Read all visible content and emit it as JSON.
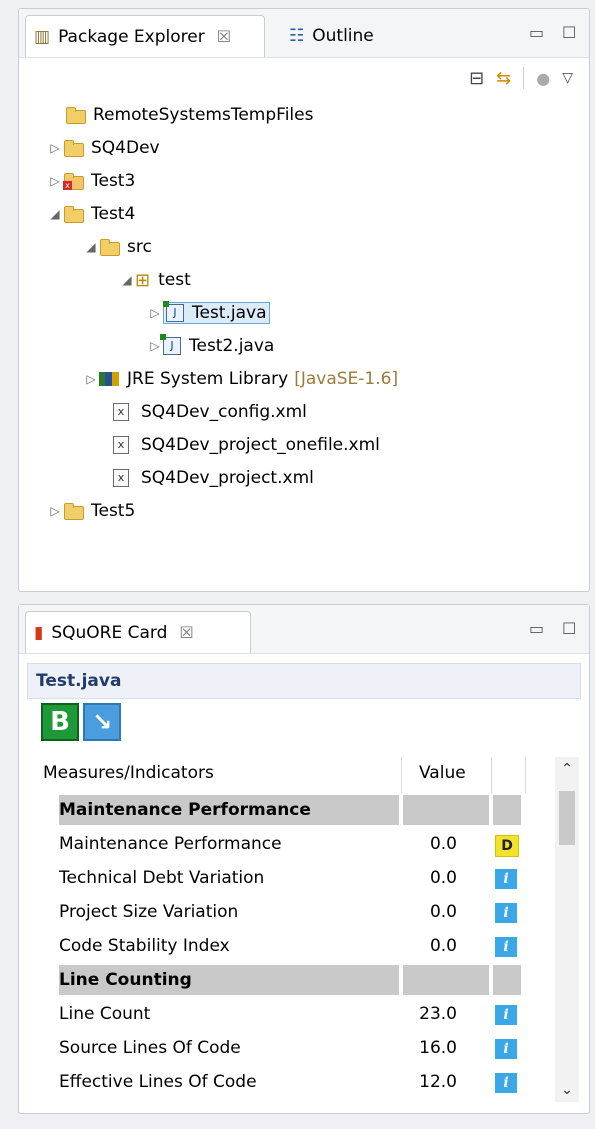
{
  "explorer": {
    "tab_label": "Package Explorer",
    "close_glyph": "☒",
    "outline_tab_label": "Outline",
    "tree": [
      {
        "label": "RemoteSystemsTempFiles",
        "level": 1,
        "twisty": "",
        "icon": "folder-icon"
      },
      {
        "label": "SQ4Dev",
        "level": 1,
        "twisty": "▷",
        "icon": "project-folder-icon"
      },
      {
        "label": "Test3",
        "level": 1,
        "twisty": "▷",
        "icon": "project-error-icon"
      },
      {
        "label": "Test4",
        "level": 1,
        "twisty": "◢",
        "icon": "project-folder-icon"
      },
      {
        "label": "src",
        "level": 2,
        "twisty": "◢",
        "icon": "source-folder-icon"
      },
      {
        "label": "test",
        "level": 3,
        "twisty": "◢",
        "icon": "package-icon"
      },
      {
        "label": "Test.java",
        "level": 4,
        "twisty": "▷",
        "icon": "java-file-icon",
        "selected": true
      },
      {
        "label": "Test2.java",
        "level": 4,
        "twisty": "▷",
        "icon": "java-file-icon"
      },
      {
        "label": "JRE System Library",
        "suffix": "[JavaSE-1.6]",
        "level": 2,
        "twisty": "▷",
        "icon": "library-icon"
      },
      {
        "label": "SQ4Dev_config.xml",
        "level": 2,
        "twisty": "",
        "icon": "xml-file-icon"
      },
      {
        "label": "SQ4Dev_project_onefile.xml",
        "level": 2,
        "twisty": "",
        "icon": "xml-file-icon"
      },
      {
        "label": "SQ4Dev_project.xml",
        "level": 2,
        "twisty": "",
        "icon": "xml-file-icon"
      },
      {
        "label": "Test5",
        "level": 1,
        "twisty": "▷",
        "icon": "project-folder-icon"
      }
    ]
  },
  "card": {
    "tab_label": "SQuORE Card",
    "close_glyph": "☒",
    "artifact": "Test.java",
    "grade": "B",
    "trend_icon": "arrow-down-right-icon",
    "columns": {
      "name": "Measures/Indicators",
      "value": "Value"
    },
    "rows": [
      {
        "type": "group",
        "name": "Maintenance Performance"
      },
      {
        "type": "row",
        "name": "Maintenance Performance",
        "value": "0.0",
        "badge": "D"
      },
      {
        "type": "row",
        "name": "Technical Debt Variation",
        "value": "0.0",
        "badge": "i"
      },
      {
        "type": "row",
        "name": "Project Size Variation",
        "value": "0.0",
        "badge": "i"
      },
      {
        "type": "row",
        "name": "Code Stability Index",
        "value": "0.0",
        "badge": "i"
      },
      {
        "type": "group",
        "name": "Line Counting"
      },
      {
        "type": "row",
        "name": "Line Count",
        "value": "23.0",
        "badge": "i"
      },
      {
        "type": "row",
        "name": "Source Lines Of Code",
        "value": "16.0",
        "badge": "i"
      },
      {
        "type": "row",
        "name": "Effective Lines Of Code",
        "value": "12.0",
        "badge": "i"
      }
    ]
  }
}
